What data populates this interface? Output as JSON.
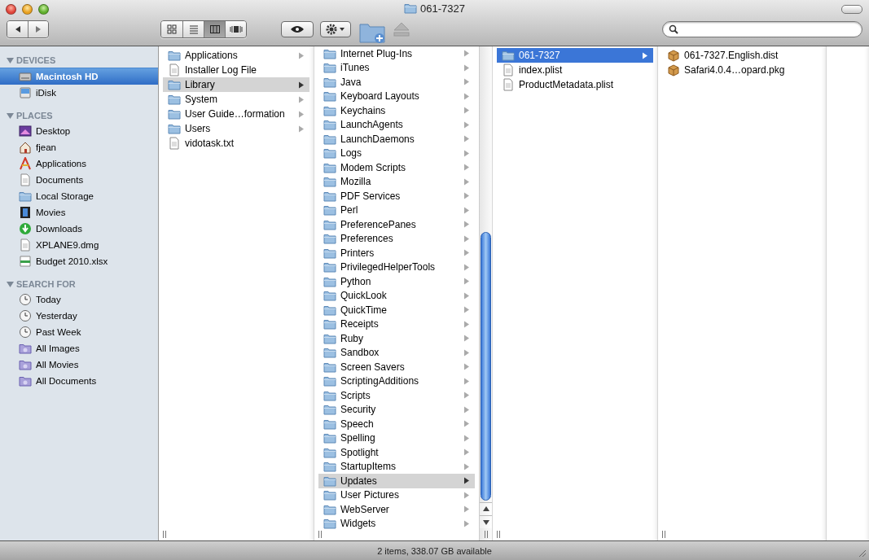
{
  "window": {
    "title": "061-7327"
  },
  "toolbar": {
    "view_modes": [
      {
        "kind": "icon",
        "selected": false
      },
      {
        "kind": "list",
        "selected": false
      },
      {
        "kind": "column",
        "selected": true
      },
      {
        "kind": "coverflow",
        "selected": false
      }
    ],
    "eject_disabled": true
  },
  "sidebar": {
    "sections": [
      {
        "title": "DEVICES",
        "expanded": true,
        "items": [
          {
            "label": "Macintosh HD",
            "kind": "drive",
            "selected": true
          },
          {
            "label": "iDisk",
            "kind": "idisk",
            "selected": false
          }
        ]
      },
      {
        "title": "PLACES",
        "expanded": true,
        "items": [
          {
            "label": "Desktop",
            "kind": "desktop",
            "selected": false
          },
          {
            "label": "fjean",
            "kind": "home",
            "selected": false
          },
          {
            "label": "Applications",
            "kind": "apps",
            "selected": false
          },
          {
            "label": "Documents",
            "kind": "file",
            "selected": false
          },
          {
            "label": "Local Storage",
            "kind": "folder",
            "selected": false
          },
          {
            "label": "Movies",
            "kind": "movies",
            "selected": false
          },
          {
            "label": "Downloads",
            "kind": "downloads",
            "selected": false
          },
          {
            "label": "XPLANE9.dmg",
            "kind": "file",
            "selected": false
          },
          {
            "label": "Budget 2010.xlsx",
            "kind": "spreadsheet",
            "selected": false
          }
        ]
      },
      {
        "title": "SEARCH FOR",
        "expanded": true,
        "items": [
          {
            "label": "Today",
            "kind": "clock",
            "selected": false
          },
          {
            "label": "Yesterday",
            "kind": "clock",
            "selected": false
          },
          {
            "label": "Past Week",
            "kind": "clock",
            "selected": false
          },
          {
            "label": "All Images",
            "kind": "smart",
            "selected": false
          },
          {
            "label": "All Movies",
            "kind": "smart",
            "selected": false
          },
          {
            "label": "All Documents",
            "kind": "smart",
            "selected": false
          }
        ]
      }
    ]
  },
  "columns": [
    {
      "items": [
        {
          "name": "Applications",
          "kind": "folder",
          "has_children": true,
          "selected": false
        },
        {
          "name": "Installer Log File",
          "kind": "file",
          "has_children": false,
          "selected": false
        },
        {
          "name": "Library",
          "kind": "folder",
          "has_children": true,
          "selected": true
        },
        {
          "name": "System",
          "kind": "folder",
          "has_children": true,
          "selected": false
        },
        {
          "name": "User Guide…formation",
          "kind": "folder",
          "has_children": true,
          "selected": false
        },
        {
          "name": "Users",
          "kind": "folder",
          "has_children": true,
          "selected": false
        },
        {
          "name": "vidotask.txt",
          "kind": "file",
          "has_children": false,
          "selected": false
        }
      ]
    },
    {
      "items": [
        {
          "name": "Internet Plug-Ins",
          "kind": "folder",
          "has_children": true,
          "selected": false
        },
        {
          "name": "iTunes",
          "kind": "folder",
          "has_children": true,
          "selected": false
        },
        {
          "name": "Java",
          "kind": "folder",
          "has_children": true,
          "selected": false
        },
        {
          "name": "Keyboard Layouts",
          "kind": "folder",
          "has_children": true,
          "selected": false
        },
        {
          "name": "Keychains",
          "kind": "folder",
          "has_children": true,
          "selected": false
        },
        {
          "name": "LaunchAgents",
          "kind": "folder",
          "has_children": true,
          "selected": false
        },
        {
          "name": "LaunchDaemons",
          "kind": "folder",
          "has_children": true,
          "selected": false
        },
        {
          "name": "Logs",
          "kind": "folder",
          "has_children": true,
          "selected": false
        },
        {
          "name": "Modem Scripts",
          "kind": "folder",
          "has_children": true,
          "selected": false
        },
        {
          "name": "Mozilla",
          "kind": "folder",
          "has_children": true,
          "selected": false
        },
        {
          "name": "PDF Services",
          "kind": "folder",
          "has_children": true,
          "selected": false
        },
        {
          "name": "Perl",
          "kind": "folder",
          "has_children": true,
          "selected": false
        },
        {
          "name": "PreferencePanes",
          "kind": "folder",
          "has_children": true,
          "selected": false
        },
        {
          "name": "Preferences",
          "kind": "folder",
          "has_children": true,
          "selected": false
        },
        {
          "name": "Printers",
          "kind": "folder",
          "has_children": true,
          "selected": false
        },
        {
          "name": "PrivilegedHelperTools",
          "kind": "folder",
          "has_children": true,
          "selected": false
        },
        {
          "name": "Python",
          "kind": "folder",
          "has_children": true,
          "selected": false
        },
        {
          "name": "QuickLook",
          "kind": "folder",
          "has_children": true,
          "selected": false
        },
        {
          "name": "QuickTime",
          "kind": "folder",
          "has_children": true,
          "selected": false
        },
        {
          "name": "Receipts",
          "kind": "folder",
          "has_children": true,
          "selected": false
        },
        {
          "name": "Ruby",
          "kind": "folder",
          "has_children": true,
          "selected": false
        },
        {
          "name": "Sandbox",
          "kind": "folder",
          "has_children": true,
          "selected": false
        },
        {
          "name": "Screen Savers",
          "kind": "folder",
          "has_children": true,
          "selected": false
        },
        {
          "name": "ScriptingAdditions",
          "kind": "folder",
          "has_children": true,
          "selected": false
        },
        {
          "name": "Scripts",
          "kind": "folder",
          "has_children": true,
          "selected": false
        },
        {
          "name": "Security",
          "kind": "folder",
          "has_children": true,
          "selected": false
        },
        {
          "name": "Speech",
          "kind": "folder",
          "has_children": true,
          "selected": false
        },
        {
          "name": "Spelling",
          "kind": "folder",
          "has_children": true,
          "selected": false
        },
        {
          "name": "Spotlight",
          "kind": "folder",
          "has_children": true,
          "selected": false
        },
        {
          "name": "StartupItems",
          "kind": "folder",
          "has_children": true,
          "selected": false
        },
        {
          "name": "Updates",
          "kind": "folder",
          "has_children": true,
          "selected": true
        },
        {
          "name": "User Pictures",
          "kind": "folder",
          "has_children": true,
          "selected": false
        },
        {
          "name": "WebServer",
          "kind": "folder",
          "has_children": true,
          "selected": false
        },
        {
          "name": "Widgets",
          "kind": "folder",
          "has_children": true,
          "selected": false
        }
      ]
    },
    {
      "items": [
        {
          "name": "061-7327",
          "kind": "folder",
          "has_children": true,
          "selected": true
        },
        {
          "name": "index.plist",
          "kind": "file",
          "has_children": false,
          "selected": false
        },
        {
          "name": "ProductMetadata.plist",
          "kind": "file",
          "has_children": false,
          "selected": false
        }
      ]
    },
    {
      "items": [
        {
          "name": "061-7327.English.dist",
          "kind": "package",
          "has_children": false,
          "selected": false
        },
        {
          "name": "Safari4.0.4…opard.pkg",
          "kind": "package",
          "has_children": false,
          "selected": false
        }
      ]
    }
  ],
  "status_bar": "2 items, 338.07 GB available"
}
